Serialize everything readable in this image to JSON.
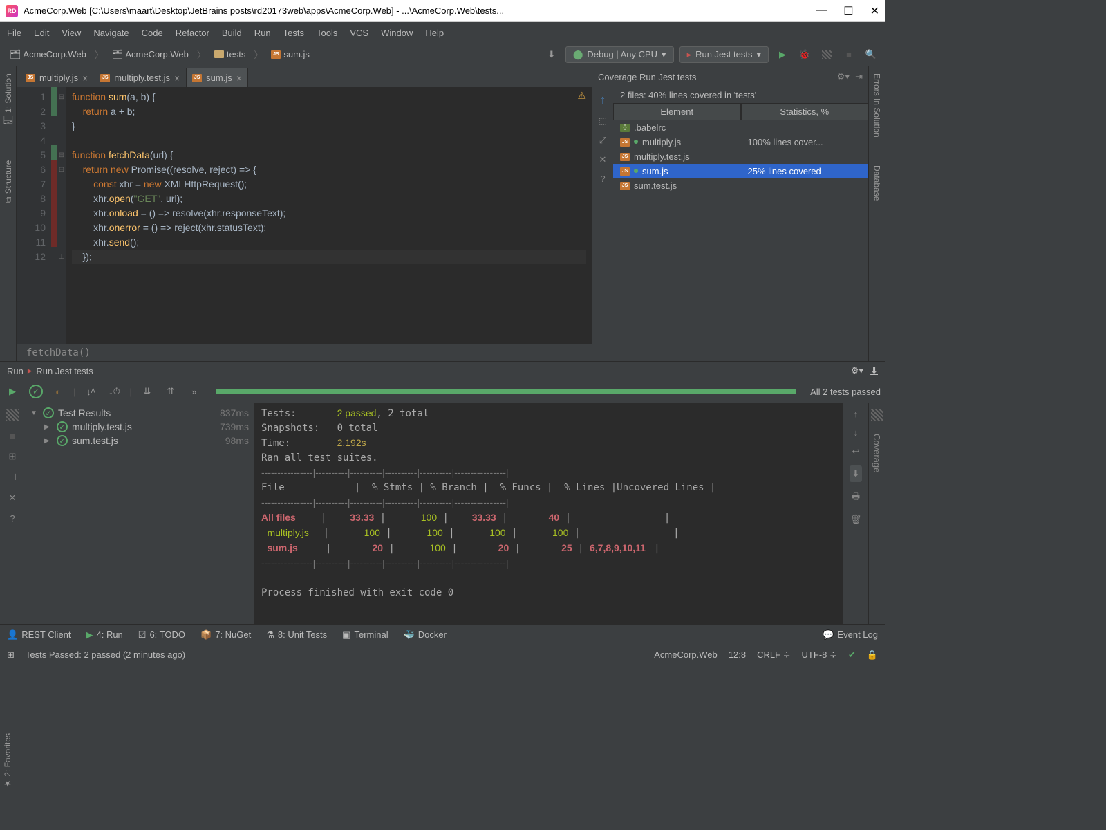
{
  "window": {
    "title": "AcmeCorp.Web [C:\\Users\\maart\\Desktop\\JetBrains posts\\rd20173web\\apps\\AcmeCorp.Web] - ...\\AcmeCorp.Web\\tests...",
    "logo": "RD"
  },
  "menubar": [
    "File",
    "Edit",
    "View",
    "Navigate",
    "Code",
    "Refactor",
    "Build",
    "Run",
    "Tests",
    "Tools",
    "VCS",
    "Window",
    "Help"
  ],
  "breadcrumb": [
    "AcmeCorp.Web",
    "AcmeCorp.Web",
    "tests",
    "sum.js"
  ],
  "config1": "Debug | Any CPU",
  "config2": "Run Jest tests",
  "left_tabs": [
    "1: Solution",
    "Structure"
  ],
  "right_tabs": [
    "Errors In Solution",
    "Database"
  ],
  "editor_tabs": [
    {
      "name": "multiply.js",
      "active": false
    },
    {
      "name": "multiply.test.js",
      "active": false
    },
    {
      "name": "sum.js",
      "active": true
    }
  ],
  "code_lines": [
    {
      "n": 1,
      "cov": "green",
      "html": "<span class='kw'>function</span> <span class='fn'>sum</span>(a, b) {"
    },
    {
      "n": 2,
      "cov": "green",
      "html": "    <span class='kw'>return</span> a + b;"
    },
    {
      "n": 3,
      "cov": "",
      "html": "}"
    },
    {
      "n": 4,
      "cov": "",
      "html": ""
    },
    {
      "n": 5,
      "cov": "green",
      "html": "<span class='kw'>function</span> <span class='fn'>fetchData</span>(url) {"
    },
    {
      "n": 6,
      "cov": "red",
      "html": "    <span class='kw'>return new</span> Promise((resolve, reject) =&gt; {"
    },
    {
      "n": 7,
      "cov": "red",
      "html": "        <span class='kw'>const</span> xhr = <span class='kw'>new</span> XMLHttpRequest();"
    },
    {
      "n": 8,
      "cov": "red",
      "html": "        xhr.<span class='fn'>open</span>(<span class='str'>\"GET\"</span>, url);"
    },
    {
      "n": 9,
      "cov": "red",
      "html": "        xhr.<span class='fn'>onload</span> = () =&gt; resolve(xhr.responseText);"
    },
    {
      "n": 10,
      "cov": "red",
      "html": "        xhr.<span class='fn'>onerror</span> = () =&gt; reject(xhr.statusText);"
    },
    {
      "n": 11,
      "cov": "red",
      "html": "        xhr.<span class='fn'>send</span>();"
    },
    {
      "n": 12,
      "cov": "",
      "html": "    });",
      "current": true
    }
  ],
  "autocomplete_hint": "fetchData()",
  "coverage": {
    "title": "Coverage Run Jest tests",
    "summary": "2 files: 40% lines covered in 'tests'",
    "cols": [
      "Element",
      "Statistics, %"
    ],
    "rows": [
      {
        "icon": "json",
        "name": ".babelrc",
        "stat": ""
      },
      {
        "icon": "js-green",
        "name": "multiply.js",
        "stat": "100% lines cover..."
      },
      {
        "icon": "js",
        "name": "multiply.test.js",
        "stat": ""
      },
      {
        "icon": "js-green",
        "name": "sum.js",
        "stat": "25% lines covered",
        "selected": true
      },
      {
        "icon": "js",
        "name": "sum.test.js",
        "stat": ""
      }
    ]
  },
  "run": {
    "label": "Run",
    "config": "Run Jest tests",
    "passed_label": "All 2 tests passed",
    "tree": [
      {
        "name": "Test Results",
        "time": "837ms",
        "depth": 0,
        "expanded": true
      },
      {
        "name": "multiply.test.js",
        "time": "739ms",
        "depth": 1,
        "expanded": false
      },
      {
        "name": "sum.test.js",
        "time": "98ms",
        "depth": 1,
        "expanded": false
      }
    ],
    "output": "Tests:       <span class='out-green'>2 passed</span>, 2 total\nSnapshots:   0 total\nTime:        <span class='out-yellow'>2.192s</span>\nRan all test suites.\n<span class='out-grey'>----------------|----------|----------|----------|----------|----------------|</span>\nFile            |  % Stmts | % Branch |  % Funcs |  % Lines |Uncovered Lines |\n<span class='out-grey'>----------------|----------|----------|----------|----------|----------------|</span>\n<span class='out-red'>All files     </span>  |    <span class='out-red'>33.33</span> |      <span class='out-green'>100</span> |    <span class='out-red'>33.33</span> |       <span class='out-red'>40</span> |                |\n <span class='out-green'>multiply.js </span>  |      <span class='out-green'>100</span> |      <span class='out-green'>100</span> |      <span class='out-green'>100</span> |      <span class='out-green'>100</span> |                |\n <span class='out-red'>sum.js      </span>  |       <span class='out-red'>20</span> |      <span class='out-green'>100</span> |       <span class='out-red'>20</span> |       <span class='out-red'>25</span> | <span class='out-red'>6,7,8,9,10,11 </span> |\n<span class='out-grey'>----------------|----------|----------|----------|----------|----------------|</span>\n\nProcess finished with exit code 0"
  },
  "bottom_bar": [
    "REST Client",
    "4: Run",
    "6: TODO",
    "7: NuGet",
    "8: Unit Tests",
    "Terminal",
    "Docker"
  ],
  "event_log": "Event Log",
  "status": {
    "msg": "Tests Passed: 2 passed (2 minutes ago)",
    "project": "AcmeCorp.Web",
    "pos": "12:8",
    "eol": "CRLF",
    "enc": "UTF-8"
  },
  "right_hatch_label": "Coverage",
  "favorites_label": "2: Favorites"
}
